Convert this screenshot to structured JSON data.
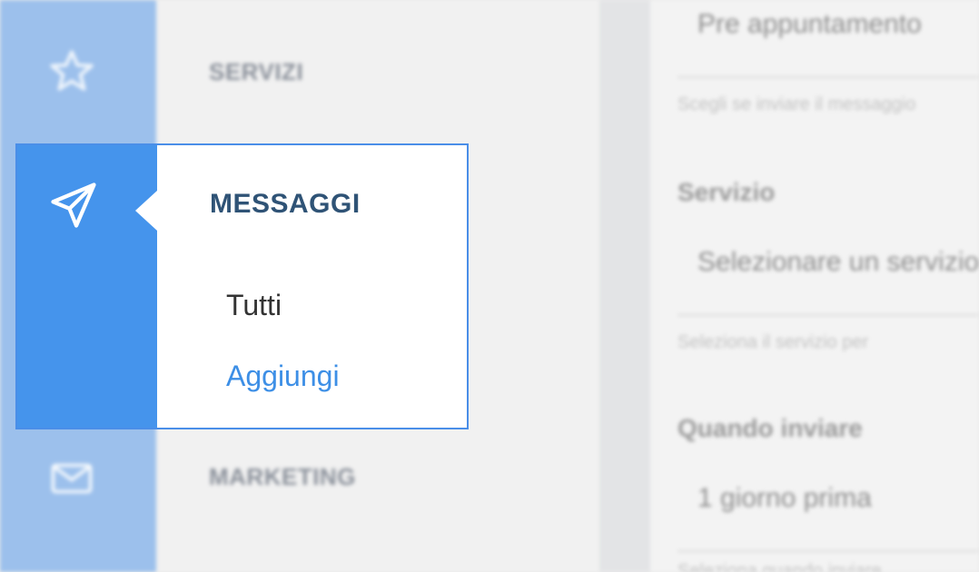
{
  "sidebar": {
    "sections": [
      {
        "label": "SERVIZI",
        "icon": "star-icon"
      },
      {
        "label": "MARKETING",
        "icon": "envelope-icon"
      }
    ]
  },
  "popup": {
    "icon": "paper-plane-icon",
    "title": "MESSAGGI",
    "items": [
      {
        "label": "Tutti"
      },
      {
        "label": "Aggiungi"
      }
    ]
  },
  "form": {
    "top_value": "Pre appuntamento",
    "top_help": "Scegli se inviare il messaggio",
    "servizio": {
      "label": "Servizio",
      "value": "Selezionare un servizio",
      "help": "Seleziona il servizio per"
    },
    "quando": {
      "label": "Quando inviare",
      "value": "1 giorno prima",
      "help": "Seleziona quando inviare"
    }
  },
  "colors": {
    "accent": "#4594ec",
    "rail_background": "#9cc0ec",
    "title": "#2f5376",
    "link": "#3d8fe6"
  }
}
